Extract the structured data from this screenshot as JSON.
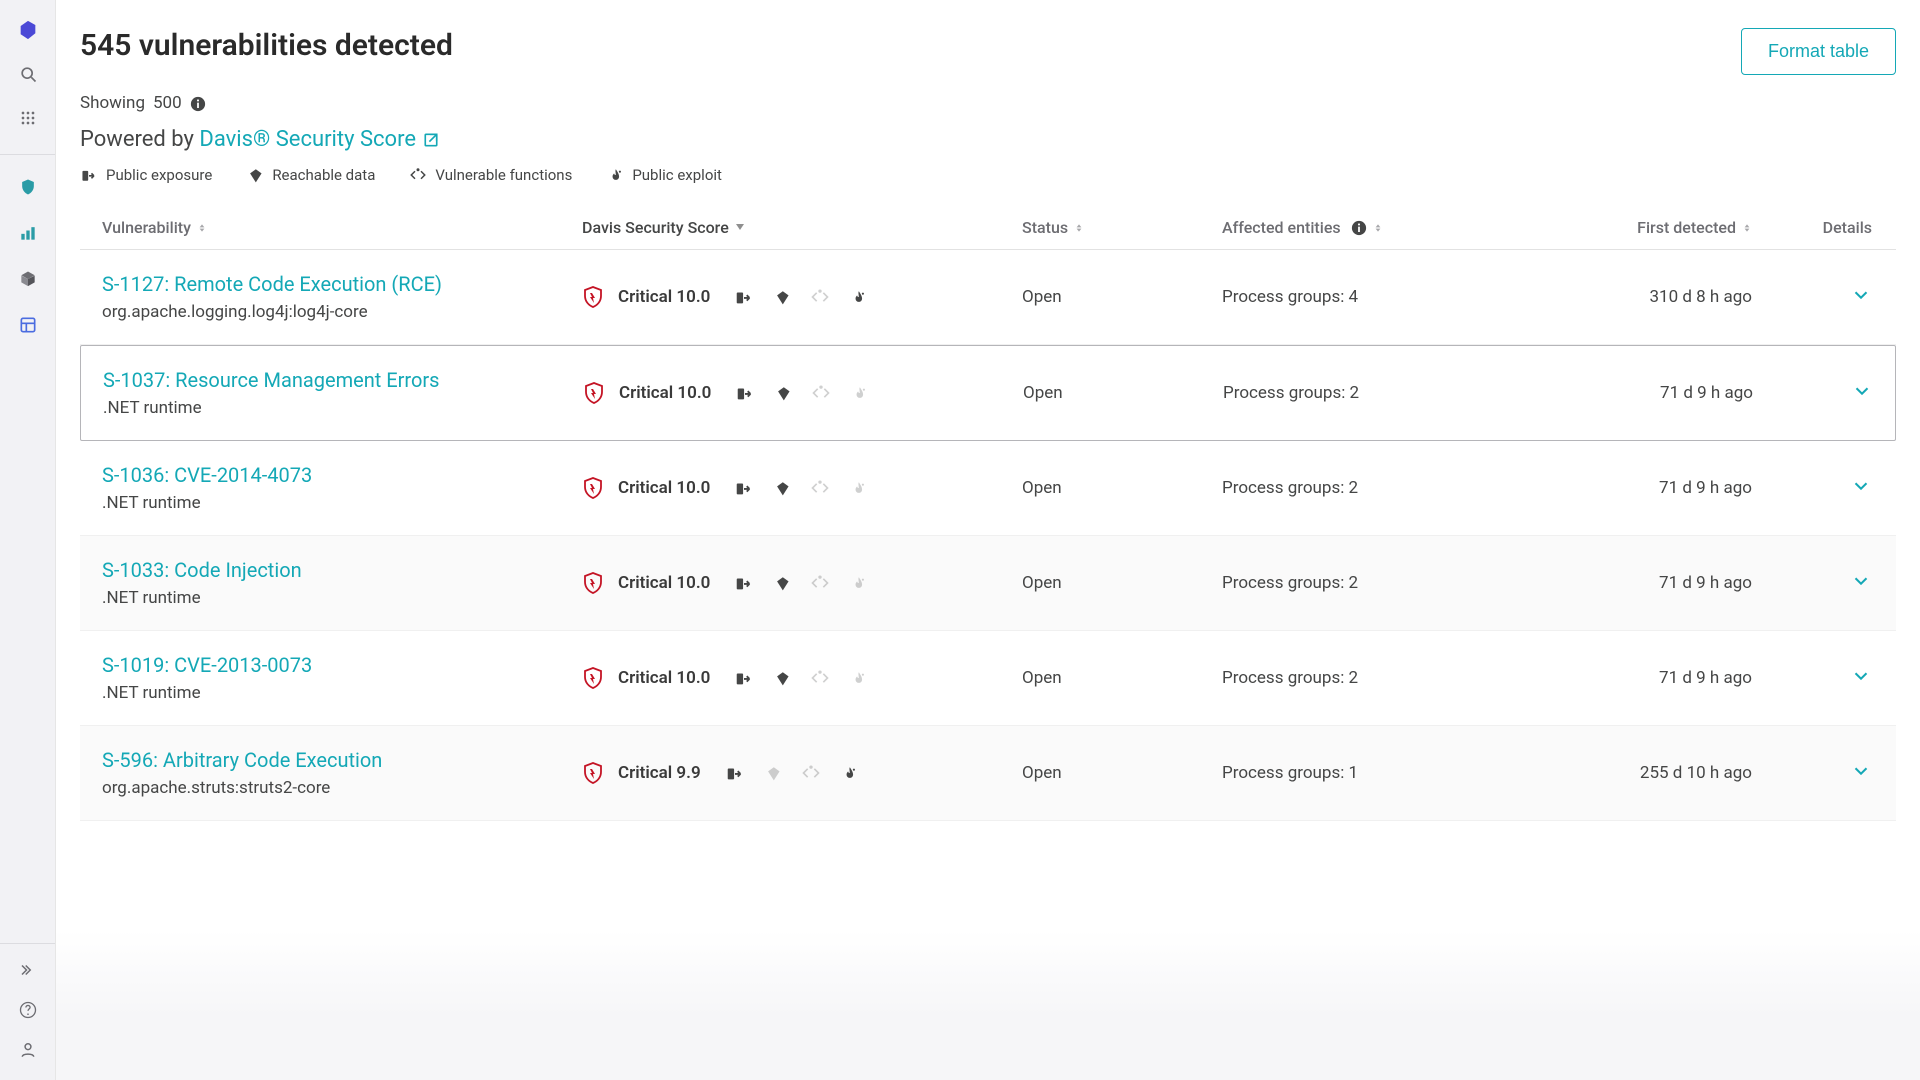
{
  "header": {
    "title": "545 vulnerabilities detected",
    "format_button": "Format table",
    "showing_prefix": "Showing ",
    "showing_count": "500",
    "powered_prefix": "Powered by ",
    "powered_link": "Davis® Security Score"
  },
  "legend": {
    "public_exposure": "Public exposure",
    "reachable_data": "Reachable data",
    "vulnerable_functions": "Vulnerable functions",
    "public_exploit": "Public exploit"
  },
  "columns": {
    "vulnerability": "Vulnerability",
    "score": "Davis Security Score",
    "status": "Status",
    "affected": "Affected entities",
    "first": "First detected",
    "details": "Details"
  },
  "rows": [
    {
      "title": "S-1127: Remote Code Execution (RCE)",
      "sub": "org.apache.logging.log4j:log4j-core",
      "severity": "Critical",
      "score": "10.0",
      "status": "Open",
      "affected": "Process groups: 4",
      "first": "310 d 8 h ago",
      "exposure": true,
      "data": true,
      "functions": false,
      "exploit": true,
      "highlight": false,
      "stripe": false
    },
    {
      "title": "S-1037: Resource Management Errors",
      "sub": ".NET runtime",
      "severity": "Critical",
      "score": "10.0",
      "status": "Open",
      "affected": "Process groups: 2",
      "first": "71 d 9 h ago",
      "exposure": true,
      "data": true,
      "functions": false,
      "exploit": false,
      "highlight": true,
      "stripe": false
    },
    {
      "title": "S-1036: CVE-2014-4073",
      "sub": ".NET runtime",
      "severity": "Critical",
      "score": "10.0",
      "status": "Open",
      "affected": "Process groups: 2",
      "first": "71 d 9 h ago",
      "exposure": true,
      "data": true,
      "functions": false,
      "exploit": false,
      "highlight": false,
      "stripe": false
    },
    {
      "title": "S-1033: Code Injection",
      "sub": ".NET runtime",
      "severity": "Critical",
      "score": "10.0",
      "status": "Open",
      "affected": "Process groups: 2",
      "first": "71 d 9 h ago",
      "exposure": true,
      "data": true,
      "functions": false,
      "exploit": false,
      "highlight": false,
      "stripe": true
    },
    {
      "title": "S-1019: CVE-2013-0073",
      "sub": ".NET runtime",
      "severity": "Critical",
      "score": "10.0",
      "status": "Open",
      "affected": "Process groups: 2",
      "first": "71 d 9 h ago",
      "exposure": true,
      "data": true,
      "functions": false,
      "exploit": false,
      "highlight": false,
      "stripe": false
    },
    {
      "title": "S-596: Arbitrary Code Execution",
      "sub": "org.apache.struts:struts2-core",
      "severity": "Critical",
      "score": "9.9",
      "status": "Open",
      "affected": "Process groups: 1",
      "first": "255 d 10 h ago",
      "exposure": true,
      "data": false,
      "functions": false,
      "exploit": true,
      "highlight": false,
      "stripe": true
    }
  ]
}
